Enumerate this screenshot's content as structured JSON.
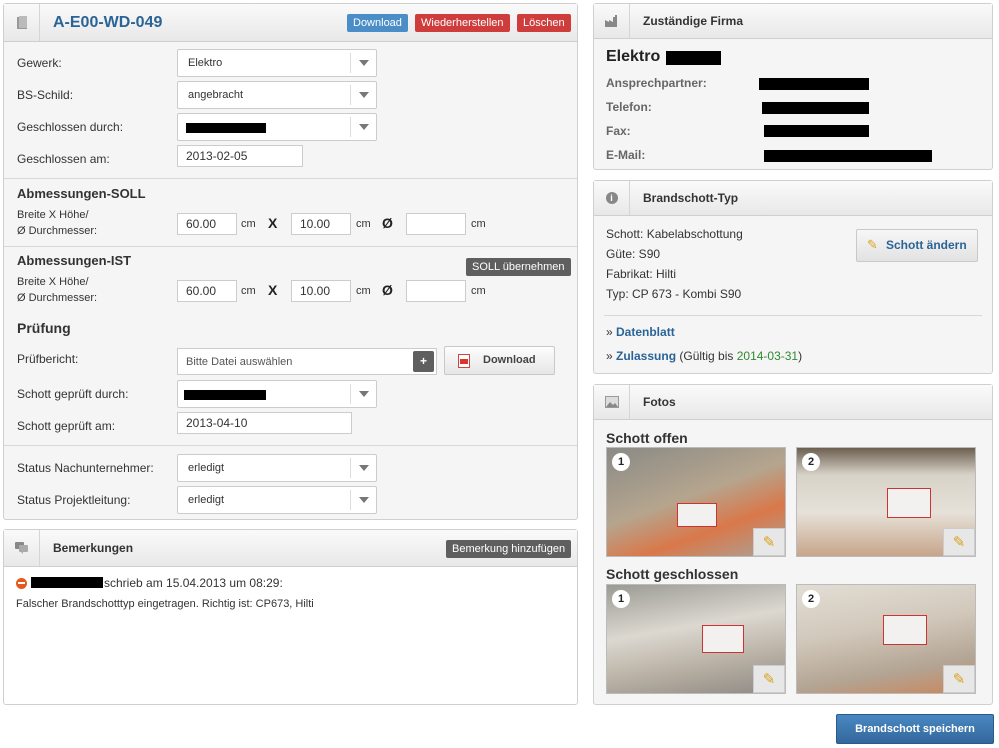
{
  "header": {
    "title": "A-E00-WD-049",
    "download": "Download",
    "restore": "Wiederherstellen",
    "delete": "Löschen"
  },
  "form": {
    "gewerk_label": "Gewerk:",
    "gewerk_value": "Elektro",
    "bs_label": "BS-Schild:",
    "bs_value": "angebracht",
    "closed_by_label": "Geschlossen durch:",
    "closed_on_label": "Geschlossen am:",
    "closed_on_value": "2013-02-05"
  },
  "soll": {
    "title": "Abmessungen-SOLL",
    "dims_label_1": "Breite X Höhe/",
    "dims_label_2": "Ø Durchmesser:",
    "width": "60.00",
    "height": "10.00",
    "diameter": "",
    "unit": "cm",
    "x": "X",
    "dia": "Ø"
  },
  "ist": {
    "title": "Abmessungen-IST",
    "apply_button": "SOLL übernehmen",
    "dims_label_1": "Breite X Höhe/",
    "dims_label_2": "Ø Durchmesser:",
    "width": "60.00",
    "height": "10.00",
    "diameter": "",
    "unit": "cm",
    "x": "X",
    "dia": "Ø"
  },
  "pruefung": {
    "title": "Prüfung",
    "report_label": "Prüfbericht:",
    "file_placeholder": "Bitte Datei auswählen",
    "add": "+",
    "download": "Download",
    "checked_by_label": "Schott geprüft durch:",
    "checked_on_label": "Schott geprüft am:",
    "checked_on_value": "2013-04-10"
  },
  "status": {
    "sub_label": "Status Nachunternehmer:",
    "sub_value": "erledigt",
    "pl_label": "Status Projektleitung:",
    "pl_value": "erledigt"
  },
  "remarks": {
    "title": "Bemerkungen",
    "add_button": "Bemerkung hinzufügen",
    "entry_meta": "schrieb am 15.04.2013 um 08:29:",
    "entry_text": "Falscher Brandschotttyp eingetragen. Richtig ist: CP673, Hilti"
  },
  "company": {
    "title": "Zuständige Firma",
    "name": "Elektro",
    "contact_label": "Ansprechpartner:",
    "phone_label": "Telefon:",
    "fax_label": "Fax:",
    "email_label": "E-Mail:"
  },
  "schott_type": {
    "title": "Brandschott-Typ",
    "line1": "Schott: Kabelabschottung",
    "line2": "Güte: S90",
    "line3": "Fabrikat: Hilti",
    "line4": "Typ: CP 673 - Kombi S90",
    "change_button": "Schott ändern",
    "datasheet_prefix": "» ",
    "datasheet": "Datenblatt",
    "approval_prefix": "» ",
    "approval": "Zulassung",
    "valid_text": " (Gültig bis ",
    "valid_date": "2014-03-31",
    "valid_close": ")"
  },
  "photos": {
    "title": "Fotos",
    "open_title": "Schott offen",
    "closed_title": "Schott geschlossen",
    "n1": "1",
    "n2": "2"
  },
  "save_button": "Brandschott speichern",
  "colors": {
    "accent_blue": "#2a6496",
    "save_blue": "#3b76b0",
    "danger_red": "#cf3c3c",
    "valid_green": "#2e8b2e"
  }
}
